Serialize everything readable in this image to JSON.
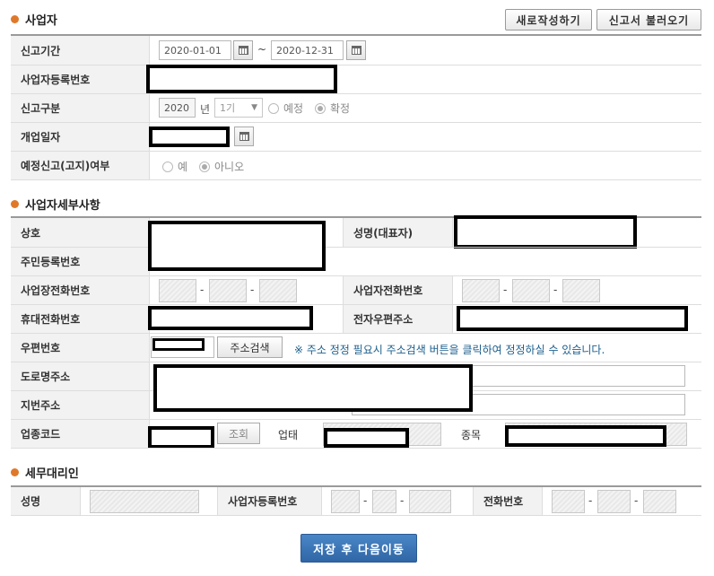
{
  "section1": {
    "title": "사업자",
    "new_button": "새로작성하기",
    "load_button": "신고서 불러오기",
    "rows": {
      "period": {
        "label": "신고기간",
        "start": "2020-01-01",
        "tilde": "~",
        "end": "2020-12-31"
      },
      "bizno": {
        "label": "사업자등록번호"
      },
      "report_type": {
        "label": "신고구분",
        "year": "2020",
        "year_unit": "년",
        "term": "1기",
        "opt1": "예정",
        "opt2": "확정"
      },
      "open_date": {
        "label": "개업일자"
      },
      "estimate": {
        "label": "예정신고(고지)여부",
        "yes": "예",
        "no": "아니오"
      }
    }
  },
  "section2": {
    "title": "사업자세부사항",
    "rows": {
      "trade_name": "상호",
      "rep_name": "성명(대표자)",
      "resident_no": "주민등록번호",
      "biz_phone": "사업장전화번호",
      "biz_phone2": "사업자전화번호",
      "mobile": "휴대전화번호",
      "email": "전자우편주소",
      "zip": "우편번호",
      "addr_search": "주소검색",
      "addr_notice": "※ 주소 정정 필요시 주소검색 버튼을 클릭하여 정정하실 수 있습니다.",
      "road_addr": "도로명주소",
      "lot_addr": "지번주소",
      "industry_code": "업종코드",
      "lookup": "조회",
      "business_type": "업태",
      "item": "종목",
      "dash": "-"
    }
  },
  "section3": {
    "title": "세무대리인",
    "name": "성명",
    "bizno": "사업자등록번호",
    "phone": "전화번호",
    "dash": "-"
  },
  "footer": {
    "save_button": "저장 후 다음이동"
  },
  "colors": {
    "accent": "#e0782a",
    "save": "#3a74b6",
    "notice": "#1b5e8c"
  },
  "icons": [
    "calendar-icon",
    "chevron-down-icon",
    "bullet-icon"
  ]
}
